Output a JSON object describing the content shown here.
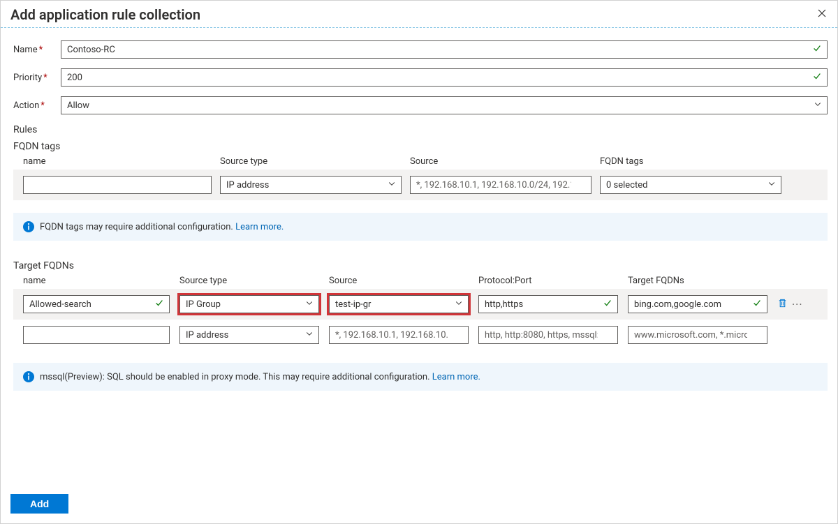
{
  "header": {
    "title": "Add application rule collection"
  },
  "form": {
    "name_label": "Name",
    "name_value": "Contoso-RC",
    "priority_label": "Priority",
    "priority_value": "200",
    "action_label": "Action",
    "action_value": "Allow"
  },
  "rules": {
    "title": "Rules"
  },
  "fqdn_tags": {
    "title": "FQDN tags",
    "headers": {
      "name": "name",
      "source_type": "Source type",
      "source": "Source",
      "fqdn_tags": "FQDN tags"
    },
    "row": {
      "source_type_value": "IP address",
      "source_placeholder": "*, 192.168.10.1, 192.168.10.0/24, 192.1...",
      "fqdn_tags_value": "0 selected"
    },
    "info_text": "FQDN tags may require additional configuration.",
    "info_link": "Learn more."
  },
  "target_fqdns": {
    "title": "Target FQDNs",
    "headers": {
      "name": "name",
      "source_type": "Source type",
      "source": "Source",
      "protocol_port": "Protocol:Port",
      "target": "Target FQDNs"
    },
    "rows": [
      {
        "name": "Allowed-search",
        "source_type": "IP Group",
        "source": "test-ip-gr",
        "protocol_port": "http,https",
        "target": "bing.com,google.com"
      }
    ],
    "blank_row": {
      "source_type": "IP address",
      "source_placeholder": "*, 192.168.10.1, 192.168.10.0/...",
      "protocol_port_placeholder": "http, http:8080, https, mssql:1...",
      "target_placeholder": "www.microsoft.com, *.micros..."
    },
    "info_text": "mssql(Preview): SQL should be enabled in proxy mode. This may require additional configuration.",
    "info_link": "Learn more."
  },
  "footer": {
    "add_label": "Add"
  }
}
